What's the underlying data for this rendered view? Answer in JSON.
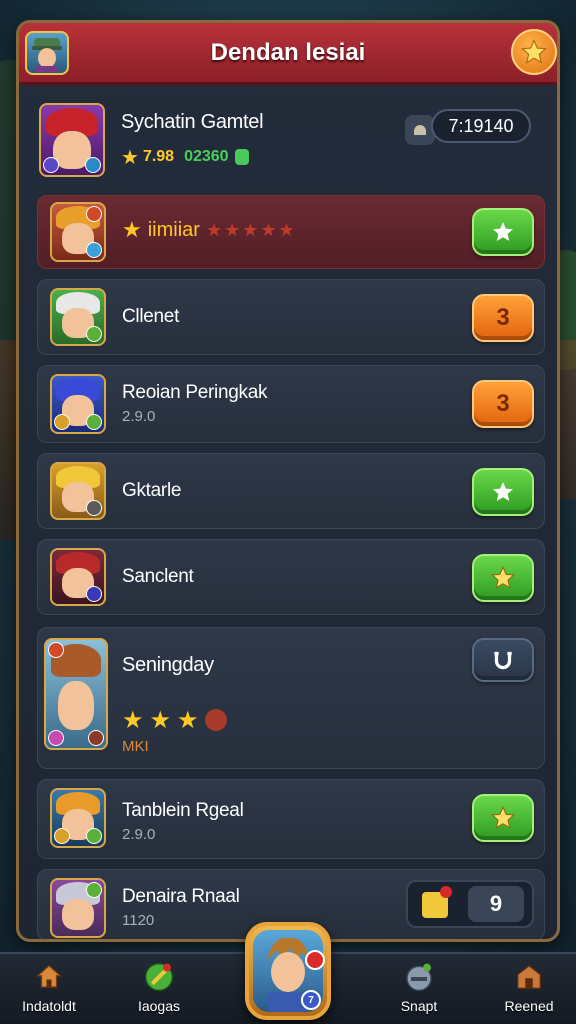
{
  "header": {
    "title": "Dendan lesiai",
    "avatar_icon": "player-avatar-icon",
    "star_icon": "star-icon"
  },
  "top_player": {
    "name": "Sychatin Gamtel",
    "gold": "7.98",
    "gems": "02360",
    "time": "7:19140"
  },
  "rows": [
    {
      "name": "iimiiar",
      "kind": "highlight",
      "stars": 5,
      "button": "star"
    },
    {
      "name": "Cllenet",
      "button_label": "3",
      "button": "orange"
    },
    {
      "name": "Reoian Peringkak",
      "sub": "2.9.0",
      "button_label": "3",
      "button": "orange"
    },
    {
      "name": "Gktarle",
      "button": "star"
    },
    {
      "name": "Sanclent",
      "button": "star-yellow"
    },
    {
      "name": "Seningday",
      "sub": "MKI",
      "stars_filled": 3,
      "button": "refresh"
    },
    {
      "name": "Tanblein Rgeal",
      "sub": "2.9.0",
      "button": "star-yellow"
    },
    {
      "name": "Denaira Rnaal",
      "sub": "1120",
      "button_label": "9",
      "button": "slate"
    }
  ],
  "nav": {
    "items": [
      {
        "label": "Indatoldt",
        "icon": "home-icon"
      },
      {
        "label": "Iaogas",
        "icon": "sword-icon"
      },
      {
        "label": "Snapt",
        "icon": "helmet-icon"
      },
      {
        "label": "Reened",
        "icon": "castle-icon"
      }
    ],
    "hero_badge": "7"
  },
  "colors": {
    "header_red": "#b8323a",
    "green_button": "#3cb02a",
    "orange_button": "#f07a1e",
    "gold_star": "#ffc928",
    "panel_bg": "#232c3a"
  }
}
